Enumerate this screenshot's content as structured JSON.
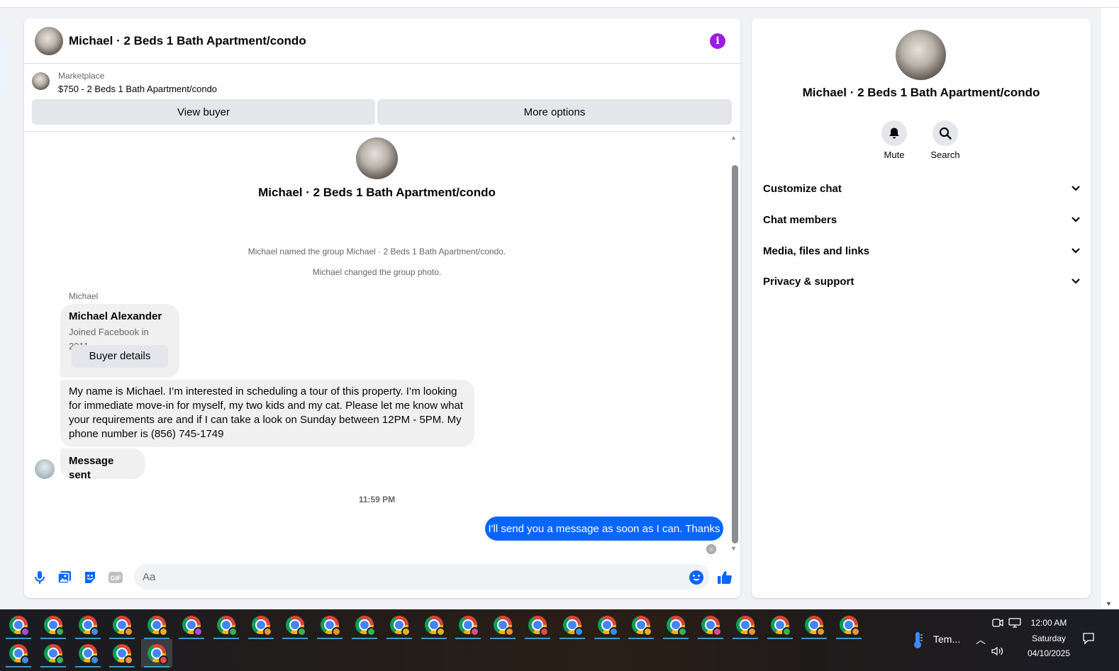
{
  "conversation": {
    "title": "Michael · 2 Beds 1 Bath Apartment/condo",
    "marketplace_label": "Marketplace",
    "listing": "$750 - 2 Beds 1 Bath Apartment/condo",
    "view_buyer": "View buyer",
    "more_options": "More options",
    "accent_color": "#9b1de0"
  },
  "thread": {
    "title": "Michael · 2 Beds 1 Bath Apartment/condo",
    "system_messages": [
      "Michael named the group Michael · 2 Beds 1 Bath Apartment/condo.",
      "Michael changed the group photo."
    ],
    "sender_name": "Michael",
    "profile_card": {
      "name": "Michael Alexander",
      "joined": "Joined Facebook in 2011",
      "button": "Buyer details"
    },
    "incoming_message": "My name is Michael. I’m interested in scheduling a tour of this property. I’m looking for immediate move-in for myself, my two kids and my cat. Please let me know what your requirements are and if I can take a look on Sunday between 12PM - 5PM. My phone number is (856) 745-1749",
    "status_message": "Message sent",
    "timestamp": "11:59 PM",
    "outgoing_message": "I'll send you a message as soon as I can. Thanks",
    "outgoing_color": "#0866ff"
  },
  "composer": {
    "placeholder": "Aa",
    "icons": [
      "microphone-icon",
      "photo-icon",
      "sticker-icon",
      "gif-icon",
      "emoji-icon",
      "like-icon"
    ],
    "gif_label": "GIF"
  },
  "details": {
    "title": "Michael · 2 Beds 1 Bath Apartment/condo",
    "actions": [
      {
        "label": "Mute",
        "icon": "bell-icon"
      },
      {
        "label": "Search",
        "icon": "search-icon"
      }
    ],
    "sections": [
      {
        "label": "Customize chat"
      },
      {
        "label": "Chat members"
      },
      {
        "label": "Media, files and links"
      },
      {
        "label": "Privacy & support"
      }
    ]
  },
  "taskbar": {
    "weather_label": "Tem...",
    "time": "12:00 AM",
    "day": "Saturday",
    "date": "04/10/2025",
    "profile_colors": [
      "#a64dd8",
      "#3fae5a",
      "#3d8fe0",
      "#e8923a",
      "#e0b02e",
      "#a64dd8",
      "#3fae5a",
      "#e8923a",
      "#3fae5a",
      "#e8923a",
      "#3fae5a",
      "#e0b02e",
      "#e0b02e",
      "#e04a8a",
      "#e8923a",
      "#e04a4a",
      "#3d8fe0",
      "#3d8fe0",
      "#e0b02e",
      "#3fae5a",
      "#e04a8a",
      "#e8923a",
      "#3fae5a",
      "#e8923a",
      "#e8923a",
      "#3d8fe0",
      "#3fae5a",
      "#3d8fe0",
      "#e8923a",
      "#e04a4a"
    ]
  }
}
